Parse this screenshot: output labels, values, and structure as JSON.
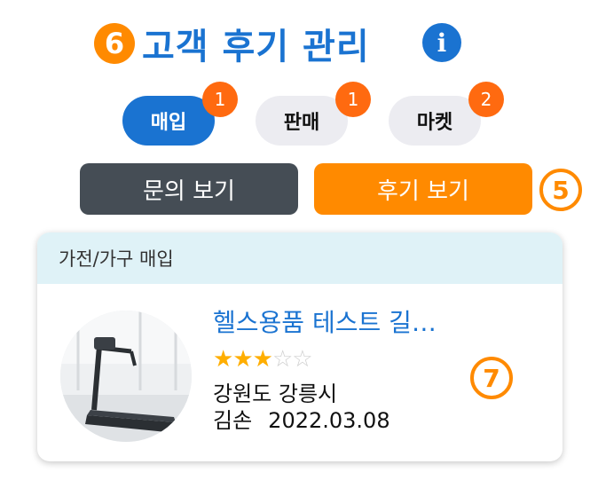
{
  "header": {
    "step_marker": "6",
    "title": "고객 후기 관리",
    "info_icon": "i"
  },
  "tabs": [
    {
      "label": "매입",
      "badge": "1",
      "active": true
    },
    {
      "label": "판매",
      "badge": "1",
      "active": false
    },
    {
      "label": "마켓",
      "badge": "2",
      "active": false
    }
  ],
  "buttons": {
    "inquiry_label": "문의 보기",
    "review_label": "후기 보기",
    "review_marker": "5"
  },
  "card": {
    "category": "가전/가구 매입",
    "title": "헬스용품 테스트 길…",
    "rating": 3,
    "rating_max": 5,
    "location": "강원도  강릉시",
    "author": "김손",
    "date": "2022.03.08",
    "marker": "7"
  },
  "colors": {
    "primary": "#1a73d1",
    "accent": "#ff8a00",
    "badge": "#ff6a10",
    "dark_button": "#454d55",
    "card_header": "#dff2f7"
  }
}
